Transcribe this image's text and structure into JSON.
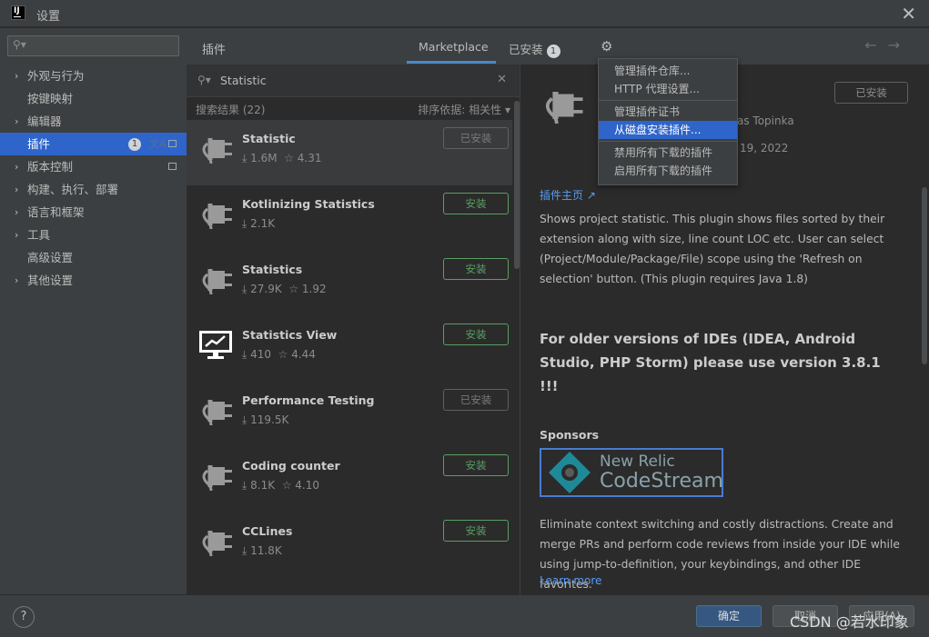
{
  "window": {
    "title": "设置",
    "app_icon_text": "IJ"
  },
  "sidebar": {
    "search_placeholder": "",
    "items": [
      {
        "label": "外观与行为",
        "expandable": true
      },
      {
        "label": "按键映射",
        "expandable": false
      },
      {
        "label": "编辑器",
        "expandable": true
      },
      {
        "label": "插件",
        "expandable": false,
        "selected": true,
        "badge": "1"
      },
      {
        "label": "版本控制",
        "expandable": true
      },
      {
        "label": "构建、执行、部署",
        "expandable": true
      },
      {
        "label": "语言和框架",
        "expandable": true
      },
      {
        "label": "工具",
        "expandable": true
      },
      {
        "label": "高级设置",
        "expandable": false
      },
      {
        "label": "其他设置",
        "expandable": true
      }
    ]
  },
  "header": {
    "title": "插件",
    "tab_marketplace": "Marketplace",
    "tab_installed": "已安装",
    "installed_count": "1"
  },
  "search": {
    "query": "Statistic",
    "results_label": "搜索结果 (22)",
    "sort_label": "排序依据: 相关性 ▾"
  },
  "plugins": [
    {
      "name": "Statistic",
      "stats": "⤓ 1.6M  ☆ 4.31",
      "button": "已安装",
      "installed": true,
      "icon": "plug-icon"
    },
    {
      "name": "Kotlinizing Statistics",
      "stats": "⤓ 2.1K",
      "button": "安装",
      "installed": false,
      "icon": "plug-icon"
    },
    {
      "name": "Statistics",
      "stats": "⤓ 27.9K  ☆ 1.92",
      "button": "安装",
      "installed": false,
      "icon": "plug-icon"
    },
    {
      "name": "Statistics View",
      "stats": "⤓ 410  ☆ 4.44",
      "button": "安装",
      "installed": false,
      "icon": "monitor-chart-icon"
    },
    {
      "name": "Performance Testing",
      "stats": "⤓ 119.5K",
      "button": "已安装",
      "installed": true,
      "icon": "plug-icon"
    },
    {
      "name": "Coding counter",
      "stats": "⤓ 8.1K  ☆ 4.10",
      "button": "安装",
      "installed": false,
      "icon": "plug-icon"
    },
    {
      "name": "CCLines",
      "stats": "⤓ 11.8K",
      "button": "安装",
      "installed": false,
      "icon": "plug-icon"
    }
  ],
  "detail": {
    "installed_button": "已安装",
    "vendor": "as Topinka",
    "date": "19, 2022",
    "homepage": "插件主页 ↗",
    "description": "Shows project statistic. This plugin shows files sorted by their extension along with size, line count LOC etc. User can select (Project/Module/Package/File) scope using the 'Refresh on selection' button. (This plugin requires Java 1.8)",
    "older_note": "For older versions of IDEs (IDEA, Android Studio, PHP Storm) please use version 3.8.1 !!!",
    "sponsors_heading": "Sponsors",
    "sponsor_line1": "New Relic",
    "sponsor_line2": "CodeStream",
    "sponsor_desc": "Eliminate context switching and costly distractions. Create and merge PRs and perform code reviews from inside your IDE while using jump-to-definition, your keybindings, and other IDE favorites.",
    "learn_more": "Learn more"
  },
  "gear_menu": {
    "items": [
      "管理插件仓库...",
      "HTTP 代理设置...",
      "管理插件证书",
      "从磁盘安装插件...",
      "禁用所有下载的插件",
      "启用所有下载的插件"
    ],
    "selected_index": 3
  },
  "footer": {
    "help": "?",
    "ok": "确定",
    "cancel": "取消",
    "apply": "应用(A)",
    "watermark": "CSDN @若水印象"
  },
  "colors": {
    "accent": "#2f65ca",
    "install_green": "#5a9e63",
    "link": "#589df6"
  }
}
